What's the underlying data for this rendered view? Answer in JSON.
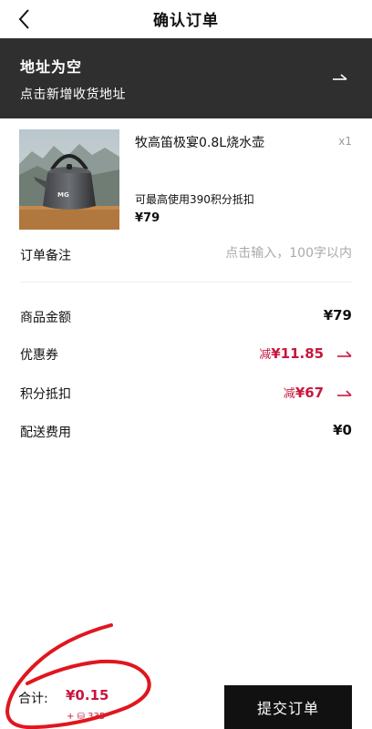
{
  "header": {
    "title": "确认订单",
    "back_icon": "chevron-left-icon"
  },
  "address": {
    "title": "地址为空",
    "subtitle": "点击新增收货地址",
    "arrow_icon": "arrow-right-icon"
  },
  "product": {
    "name": "牧高笛极宴0.8L烧水壶",
    "quantity": "x1",
    "points_note": "可最高使用390积分抵扣",
    "price": "¥79",
    "image": "kettle-product-image"
  },
  "remark": {
    "label": "订单备注",
    "placeholder": "点击输入，100字以内"
  },
  "fees": {
    "goods": {
      "label": "商品金额",
      "value": "¥79"
    },
    "coupon": {
      "label": "优惠券",
      "prefix": "减",
      "value": "¥11.85"
    },
    "points": {
      "label": "积分抵扣",
      "prefix": "减",
      "value": "¥67"
    },
    "shipping": {
      "label": "配送费用",
      "value": "¥0"
    }
  },
  "footer": {
    "total_label": "合计:",
    "total_value": "¥0.15",
    "points_used": "+ ⛁ 335",
    "submit_label": "提交订单"
  },
  "colors": {
    "accent_red": "#c8173c",
    "dark_banner": "#2f2f2f",
    "button_black": "#111111"
  }
}
